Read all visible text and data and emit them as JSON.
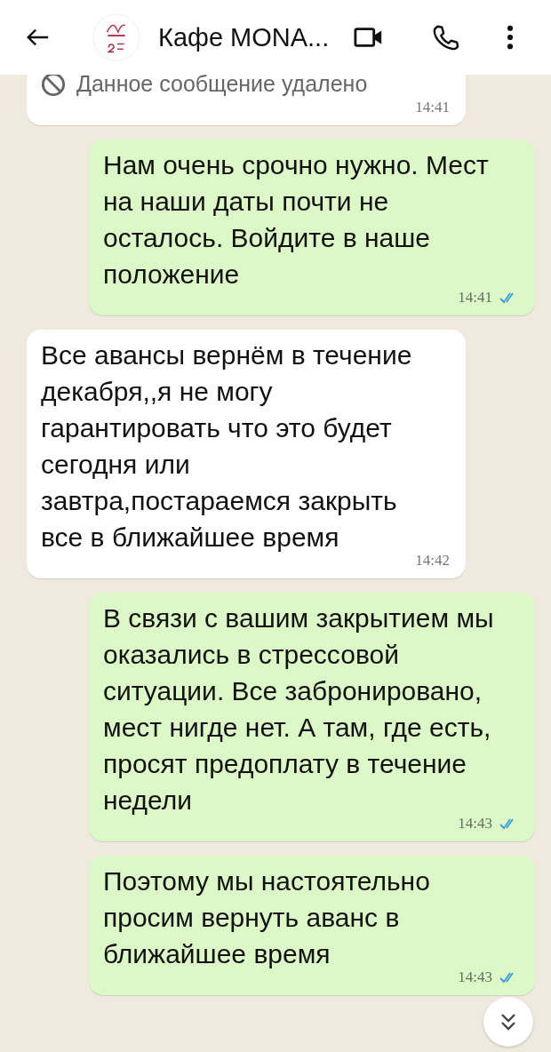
{
  "header": {
    "title": "Кафе MONA..."
  },
  "messages": [
    {
      "kind": "deleted",
      "outgoing": false,
      "text": "Данное сообщение удалено",
      "time": "14:41"
    },
    {
      "kind": "text",
      "outgoing": true,
      "text": "Нам очень срочно нужно. Мест на наши даты почти не осталось. Войдите в наше положение",
      "time": "14:41",
      "read": true
    },
    {
      "kind": "text",
      "outgoing": false,
      "text": "Все авансы вернём в течение декабря,,я не могу гарантировать что это будет сегодня или завтра,постараемся закрыть все в ближайшее время",
      "time": "14:42"
    },
    {
      "kind": "text",
      "outgoing": true,
      "text": "В связи с вашим закрытием мы оказались в стрессовой ситуации. Все забронировано, мест нигде нет. А там, где есть, просят предоплату в течение недели",
      "time": "14:43",
      "read": true
    },
    {
      "kind": "text",
      "outgoing": true,
      "text": "Поэтому мы настоятельно просим вернуть аванс в ближайшее время",
      "time": "14:43",
      "read": true
    }
  ]
}
